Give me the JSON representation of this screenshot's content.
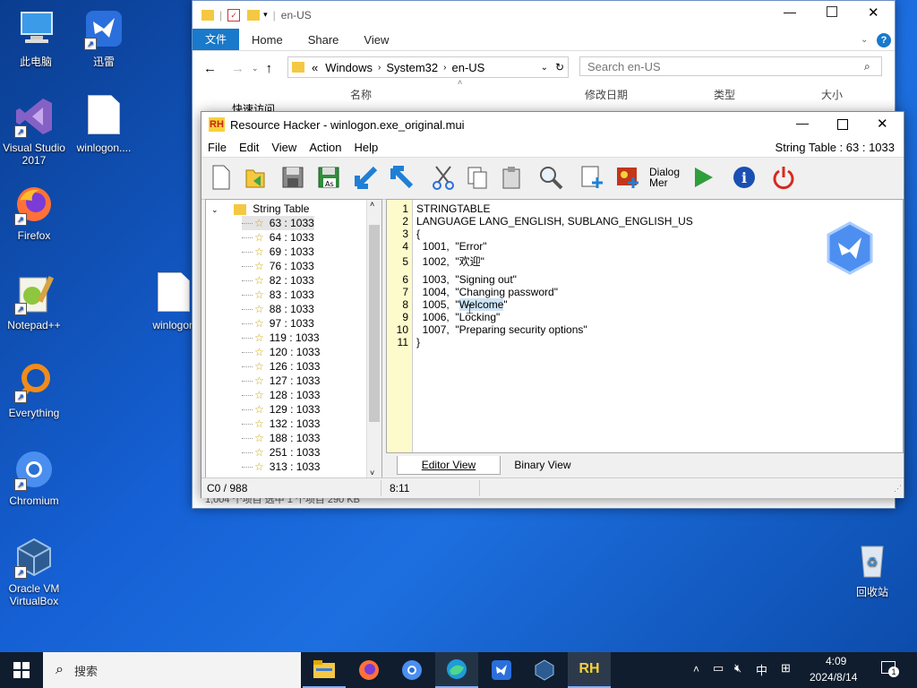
{
  "desktop": {
    "icons": [
      {
        "label": "此电脑",
        "icon": "computer-icon"
      },
      {
        "label": "迅雷",
        "icon": "thunder-bird-icon"
      },
      {
        "label": "Visual Studio 2017",
        "icon": "visual-studio-icon"
      },
      {
        "label": "winlogon....",
        "icon": "file-icon"
      },
      {
        "label": "Firefox",
        "icon": "firefox-icon"
      },
      {
        "label": "Notepad++",
        "icon": "notepadpp-icon"
      },
      {
        "label": "winlogon",
        "icon": "file-icon"
      },
      {
        "label": "Everything",
        "icon": "everything-icon"
      },
      {
        "label": "Chromium",
        "icon": "chromium-icon"
      },
      {
        "label": "Oracle VM VirtualBox",
        "icon": "virtualbox-icon"
      },
      {
        "label": "回收站",
        "icon": "recycle-bin-icon"
      }
    ]
  },
  "explorer": {
    "title": "en-US",
    "ribbon": {
      "file": "文件",
      "tabs": [
        "Home",
        "Share",
        "View"
      ]
    },
    "address": {
      "prefix": "«",
      "crumbs": [
        "Windows",
        "System32",
        "en-US"
      ]
    },
    "search_placeholder": "Search en-US",
    "columns": [
      "名称",
      "修改日期",
      "类型",
      "大小"
    ],
    "quick_access": "快速访问",
    "status_partial": "1,004 个项目   选中 1 个项目  290 KB"
  },
  "rh": {
    "title": "Resource Hacker - winlogon.exe_original.mui",
    "menu": [
      "File",
      "Edit",
      "View",
      "Action",
      "Help"
    ],
    "section_label": "String Table : 63 : 1033",
    "toolbar_dialog_label": "Dialog Mer",
    "tree": {
      "root": "String Table",
      "items": [
        "63 : 1033",
        "64 : 1033",
        "69 : 1033",
        "76 : 1033",
        "82 : 1033",
        "83 : 1033",
        "88 : 1033",
        "97 : 1033",
        "119 : 1033",
        "120 : 1033",
        "126 : 1033",
        "127 : 1033",
        "128 : 1033",
        "129 : 1033",
        "132 : 1033",
        "188 : 1033",
        "251 : 1033",
        "313 : 1033"
      ]
    },
    "editor": {
      "lines": [
        {
          "num": "1",
          "text": "STRINGTABLE"
        },
        {
          "num": "2",
          "text": "LANGUAGE LANG_ENGLISH, SUBLANG_ENGLISH_US"
        },
        {
          "num": "3",
          "text": "{"
        },
        {
          "num": "4",
          "text": "  1001,  \"Error\""
        },
        {
          "num": "5",
          "text": "  1002,  \"欢迎\""
        },
        {
          "num": "6",
          "text": "  1003,  \"Signing out\""
        },
        {
          "num": "7",
          "text": "  1004,  \"Changing password\""
        },
        {
          "num": "8",
          "text": "  1005,  \"Welcome\""
        },
        {
          "num": "9",
          "text": "  1006,  \"Locking\""
        },
        {
          "num": "10",
          "text": "  1007,  \"Preparing security options\""
        },
        {
          "num": "11",
          "text": "}"
        }
      ],
      "selected_word": "Welcome"
    },
    "tabs": [
      "Editor View",
      "Binary View"
    ],
    "status_left": "C0 / 988",
    "status_cursor": "8:11"
  },
  "taskbar": {
    "search_label": "搜索",
    "ime": "中",
    "time": "4:09",
    "date": "2024/8/14",
    "notification_badge": "1"
  },
  "colors": {
    "accent": "#1979ca",
    "gutter": "#fdfbcc",
    "selection": "#cde4f7"
  }
}
